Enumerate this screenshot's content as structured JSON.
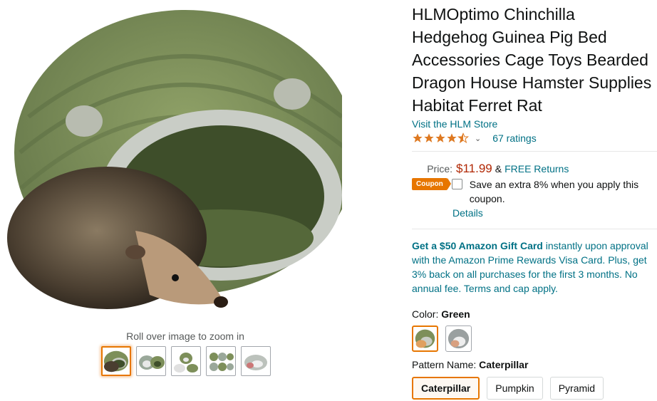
{
  "gallery": {
    "zoom_hint": "Roll over image to zoom in",
    "thumbnail_count": 5,
    "selected_index": 0
  },
  "product": {
    "title": "HLMOptimo Chinchilla Hedgehog Guinea Pig Bed Accessories Cage Toys Bearded Dragon House Hamster Supplies Habitat Ferret Rat",
    "store_link": "Visit the HLM Store",
    "rating_value": 4.5,
    "ratings_count": "67 ratings"
  },
  "price": {
    "label": "Price:",
    "value": "$11.99",
    "amp": "&",
    "returns": "FREE Returns"
  },
  "coupon": {
    "badge": "Coupon",
    "text": "Save an extra 8% when you apply this coupon.",
    "details": "Details"
  },
  "promo": {
    "bold": "Get a $50 Amazon Gift Card",
    "rest": " instantly upon approval with the Amazon Prime Rewards Visa Card. Plus, get 3% back on all purchases for the first 3 months. No annual fee. Terms and cap apply."
  },
  "color": {
    "label": "Color: ",
    "selected": "Green"
  },
  "pattern": {
    "label": "Pattern Name: ",
    "selected": "Caterpillar",
    "options": [
      "Caterpillar",
      "Pumpkin",
      "Pyramid"
    ]
  },
  "colors": {
    "accent_orange": "#e77600",
    "price_red": "#B12704",
    "link_teal": "#007185",
    "bed_green": "#7d8f5a"
  }
}
